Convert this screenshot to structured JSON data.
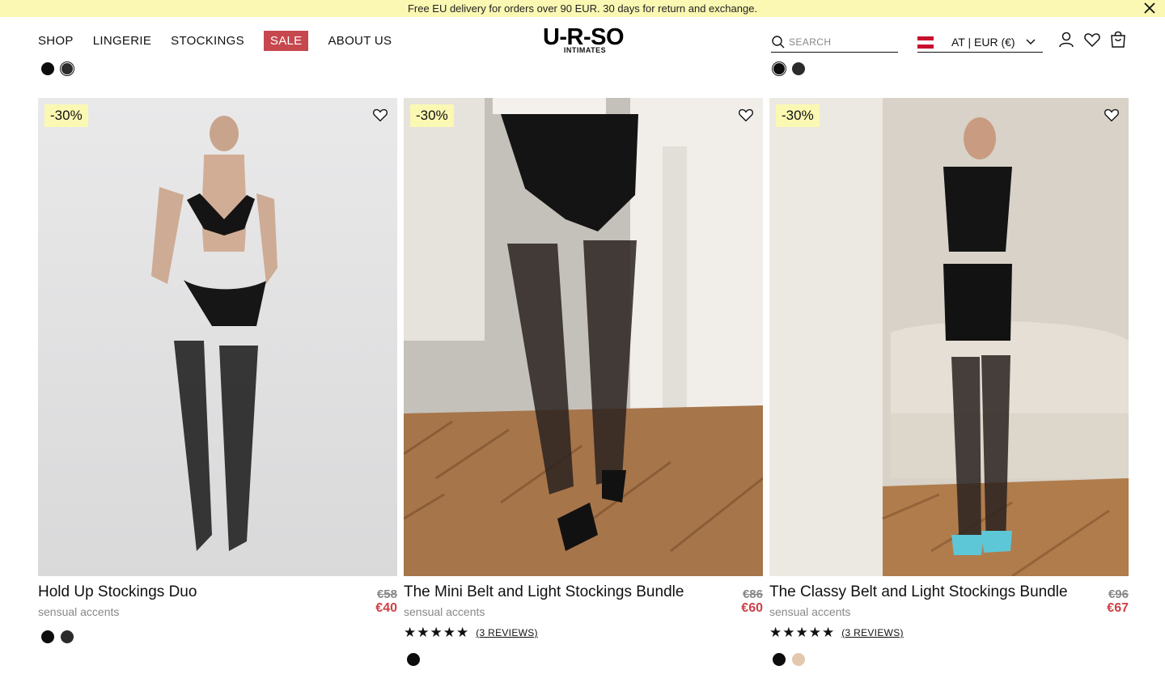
{
  "announcement": {
    "text": "Free EU delivery for orders over 90 EUR. 30 days for return and exchange."
  },
  "nav": {
    "shop": "SHOP",
    "lingerie": "LINGERIE",
    "stockings": "STOCKINGS",
    "sale": "SALE",
    "about": "ABOUT US"
  },
  "logo": {
    "main": "U-R-SO",
    "sub": "INTIMATES"
  },
  "search": {
    "placeholder": "SEARCH"
  },
  "locale": {
    "label": "AT | EUR (€)"
  },
  "colors": {
    "accent_sale": "#c6474d",
    "price_new": "#d04047",
    "banner": "#fbf8b3",
    "swatch_black": "#0d0d0d",
    "swatch_charcoal": "#2b2b2b",
    "swatch_nude": "#e3c8ae"
  },
  "products": [
    {
      "badge": "-30%",
      "title": "Hold Up Stockings Duo",
      "subtitle": "sensual accents",
      "old_price": "€58",
      "new_price": "€40",
      "stars": "",
      "reviews": ""
    },
    {
      "badge": "-30%",
      "title": "The Mini Belt and Light Stockings Bundle",
      "subtitle": "sensual accents",
      "old_price": "€86",
      "new_price": "€60",
      "stars": "★★★★★",
      "reviews": "(3 REVIEWS)"
    },
    {
      "badge": "-30%",
      "title": "The Classy Belt and Light Stockings Bundle",
      "subtitle": "sensual accents",
      "old_price": "€96",
      "new_price": "€67",
      "stars": "★★★★★",
      "reviews": "(3 REVIEWS)"
    }
  ]
}
